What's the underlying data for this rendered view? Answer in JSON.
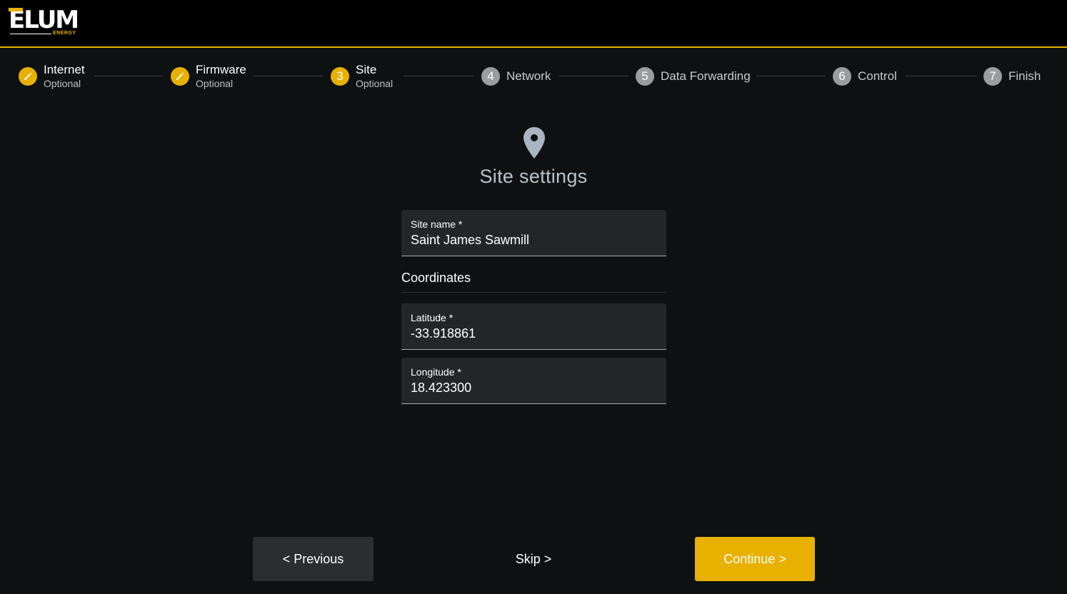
{
  "brand": {
    "name": "ELUM",
    "subtitle": "ENERGY",
    "accent_color": "#e8b100"
  },
  "stepper": {
    "steps": [
      {
        "number": "1",
        "label": "Internet",
        "sub": "Optional",
        "state": "done",
        "icon": "pencil-icon"
      },
      {
        "number": "2",
        "label": "Firmware",
        "sub": "Optional",
        "state": "done",
        "icon": "pencil-icon"
      },
      {
        "number": "3",
        "label": "Site",
        "sub": "Optional",
        "state": "active"
      },
      {
        "number": "4",
        "label": "Network",
        "sub": "",
        "state": "todo"
      },
      {
        "number": "5",
        "label": "Data Forwarding",
        "sub": "",
        "state": "todo"
      },
      {
        "number": "6",
        "label": "Control",
        "sub": "",
        "state": "todo"
      },
      {
        "number": "7",
        "label": "Finish",
        "sub": "",
        "state": "todo"
      }
    ]
  },
  "main": {
    "icon": "map-pin-icon",
    "title": "Site settings",
    "site_name": {
      "label": "Site name *",
      "value": "Saint James Sawmill"
    },
    "coordinates_heading": "Coordinates",
    "latitude": {
      "label": "Latitude *",
      "value": "-33.918861"
    },
    "longitude": {
      "label": "Longitude *",
      "value": "18.423300"
    }
  },
  "actions": {
    "previous": "< Previous",
    "skip": "Skip >",
    "continue": "Continue >"
  }
}
